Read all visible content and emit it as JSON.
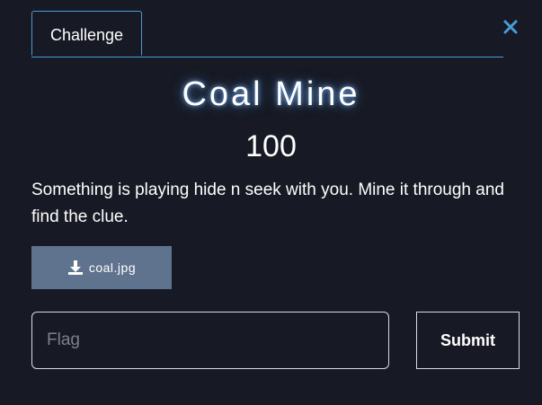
{
  "tabs": [
    {
      "label": "Challenge",
      "active": true
    }
  ],
  "challenge": {
    "name": "Coal Mine",
    "points": "100",
    "description": "Something is playing hide n seek with you. Mine it through and find the clue."
  },
  "file": {
    "name": "coal.jpg",
    "icon": "download-icon"
  },
  "flag_input": {
    "placeholder": "Flag",
    "value": ""
  },
  "submit": {
    "label": "Submit"
  },
  "close": {
    "icon": "close-icon"
  },
  "colors": {
    "background": "#171a24",
    "accent": "#4a9bd6",
    "file_button": "#5f738f",
    "border": "#d8dbe0"
  }
}
